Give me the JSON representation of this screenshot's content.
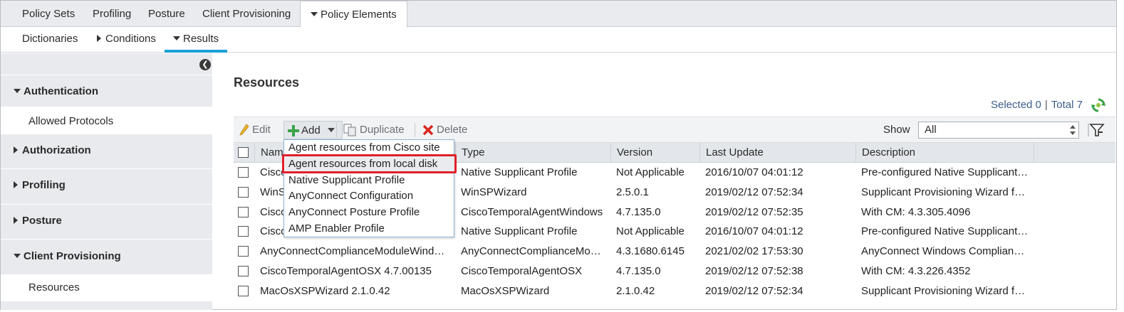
{
  "top_nav": {
    "tabs": [
      "Policy Sets",
      "Profiling",
      "Posture",
      "Client Provisioning",
      "Policy Elements"
    ]
  },
  "sub_nav": {
    "items": [
      "Dictionaries",
      "Conditions",
      "Results"
    ]
  },
  "sidebar": {
    "sections": [
      "Authentication",
      "Authorization",
      "Profiling",
      "Posture",
      "Client Provisioning"
    ],
    "authentication_items": [
      "Allowed Protocols"
    ],
    "client_provisioning_items": [
      "Resources"
    ]
  },
  "main": {
    "title": "Resources",
    "selected_label": "Selected 0",
    "total_label": "Total 7",
    "separator": "|"
  },
  "toolbar": {
    "edit": "Edit",
    "add": "Add",
    "duplicate": "Duplicate",
    "delete": "Delete",
    "show_label": "Show",
    "show_value": "All"
  },
  "add_menu": {
    "items": [
      "Agent resources from Cisco site",
      "Agent resources from local disk",
      "Native Supplicant Profile",
      "AnyConnect Configuration",
      "AnyConnect Posture Profile",
      "AMP Enabler Profile"
    ]
  },
  "table": {
    "columns": [
      "Nam",
      "Type",
      "Version",
      "Last Update",
      "Description"
    ],
    "rows": [
      {
        "name": "Cisco",
        "type": "Native Supplicant Profile",
        "version": "Not Applicable",
        "updated": "2016/10/07 04:01:12",
        "desc": "Pre-configured Native Supplicant…"
      },
      {
        "name": "WinS",
        "type": "WinSPWizard",
        "version": "2.5.0.1",
        "updated": "2019/02/12 07:52:34",
        "desc": "Supplicant Provisioning Wizard f…"
      },
      {
        "name": "Cisco",
        "type": "CiscoTemporalAgentWindows",
        "version": "4.7.135.0",
        "updated": "2019/02/12 07:52:35",
        "desc": "With CM: 4.3.305.4096"
      },
      {
        "name": "Cisco",
        "type": "Native Supplicant Profile",
        "version": "Not Applicable",
        "updated": "2016/10/07 04:01:12",
        "desc": "Pre-configured Native Supplicant…"
      },
      {
        "name": "AnyConnectComplianceModuleWind…",
        "type": "AnyConnectComplianceMo…",
        "version": "4.3.1680.6145",
        "updated": "2021/02/02 17:53:30",
        "desc": "AnyConnect Windows Complian…"
      },
      {
        "name": "CiscoTemporalAgentOSX 4.7.00135",
        "type": "CiscoTemporalAgentOSX",
        "version": "4.7.135.0",
        "updated": "2019/02/12 07:52:38",
        "desc": "With CM: 4.3.226.4352"
      },
      {
        "name": "MacOsXSPWizard 2.1.0.42",
        "type": "MacOsXSPWizard",
        "version": "2.1.0.42",
        "updated": "2019/02/12 07:52:34",
        "desc": "Supplicant Provisioning Wizard f…"
      }
    ]
  },
  "colors": {
    "accent": "#1aa0d8",
    "highlight_box": "#e0202a",
    "count_text": "#3b5d8a"
  }
}
